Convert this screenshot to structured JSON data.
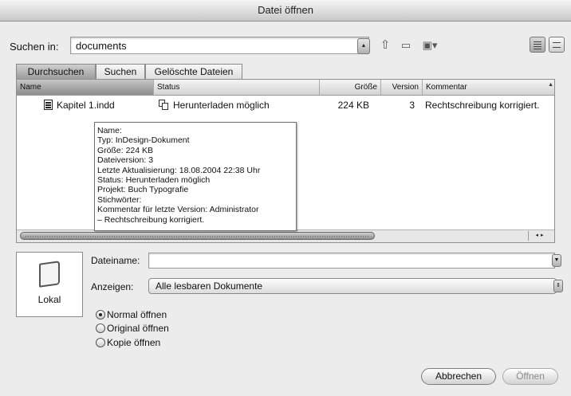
{
  "window": {
    "title": "Datei öffnen"
  },
  "lookin": {
    "label": "Suchen in:",
    "value": "documents"
  },
  "toolbar": {
    "up_icon": "up-folder-icon",
    "new_folder_icon": "new-folder-icon",
    "fetch_icon": "repository-icon"
  },
  "tabs": [
    {
      "label": "Durchsuchen",
      "active": true
    },
    {
      "label": "Suchen",
      "active": false
    },
    {
      "label": "Gelöschte Dateien",
      "active": false
    }
  ],
  "columns": [
    {
      "label": "Name"
    },
    {
      "label": "Status"
    },
    {
      "label": "Größe"
    },
    {
      "label": "Version"
    },
    {
      "label": "Kommentar"
    }
  ],
  "file": {
    "name": "Kapitel 1.indd",
    "status": "Herunterladen möglich",
    "size": "224 KB",
    "version": "3",
    "comment": "Rechtschreibung korrigiert."
  },
  "tooltip": {
    "lines": [
      "Name:",
      "Typ: InDesign-Dokument",
      "Größe: 224 KB",
      "Dateiversion: 3",
      "Letzte Aktualisierung: 18.08.2004 22:38 Uhr",
      "Status: Herunterladen möglich",
      "Projekt: Buch Typografie",
      "Stichwörter:",
      "Kommentar für letzte Version: Administrator",
      "– Rechtschreibung korrigiert."
    ]
  },
  "location": {
    "label": "Lokal"
  },
  "filename": {
    "label": "Dateiname:",
    "value": ""
  },
  "show": {
    "label": "Anzeigen:",
    "value": "Alle lesbaren Dokumente"
  },
  "open_options": [
    {
      "label": "Normal öffnen",
      "selected": true
    },
    {
      "label": "Original öffnen",
      "selected": false
    },
    {
      "label": "Kopie öffnen",
      "selected": false
    }
  ],
  "buttons": {
    "cancel": "Abbrechen",
    "open": "Öffnen"
  }
}
